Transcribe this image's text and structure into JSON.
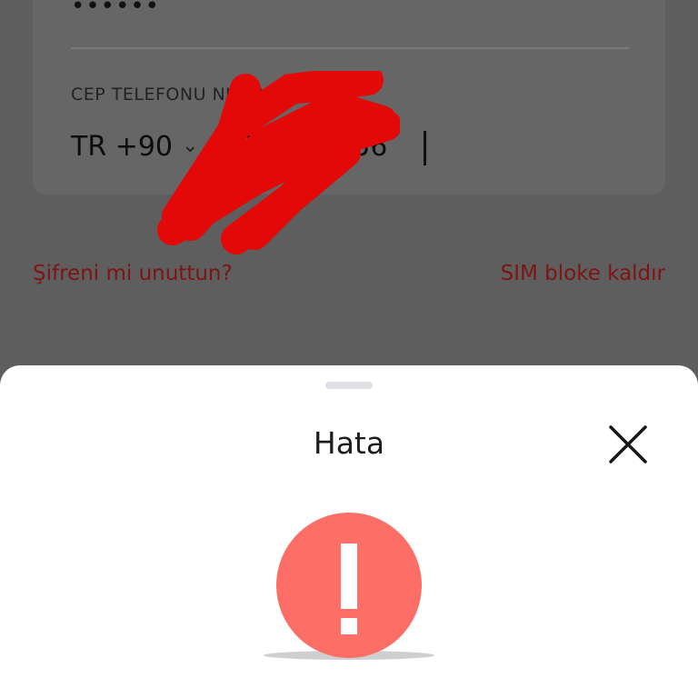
{
  "login_form": {
    "password_mask": "••••••",
    "phone_label": "CEP TELEFONU NUMARASI",
    "country_code": "TR +90",
    "country_chevron": "⌄",
    "phone_number_visible": "5",
    "phone_number_tail": "256",
    "redaction_color": "#e30909"
  },
  "links": {
    "forgot_password": "Şifreni mi unuttun?",
    "sim_unblock": "SIM bloke kaldır"
  },
  "error_sheet": {
    "title": "Hata",
    "close_icon": "close-icon",
    "alert_icon": "exclamation-circle-icon",
    "alert_color": "#fd6f66"
  },
  "colors": {
    "overlay": "#5e5e5e",
    "link": "#7e1414",
    "sheet_bg": "#ffffff"
  }
}
